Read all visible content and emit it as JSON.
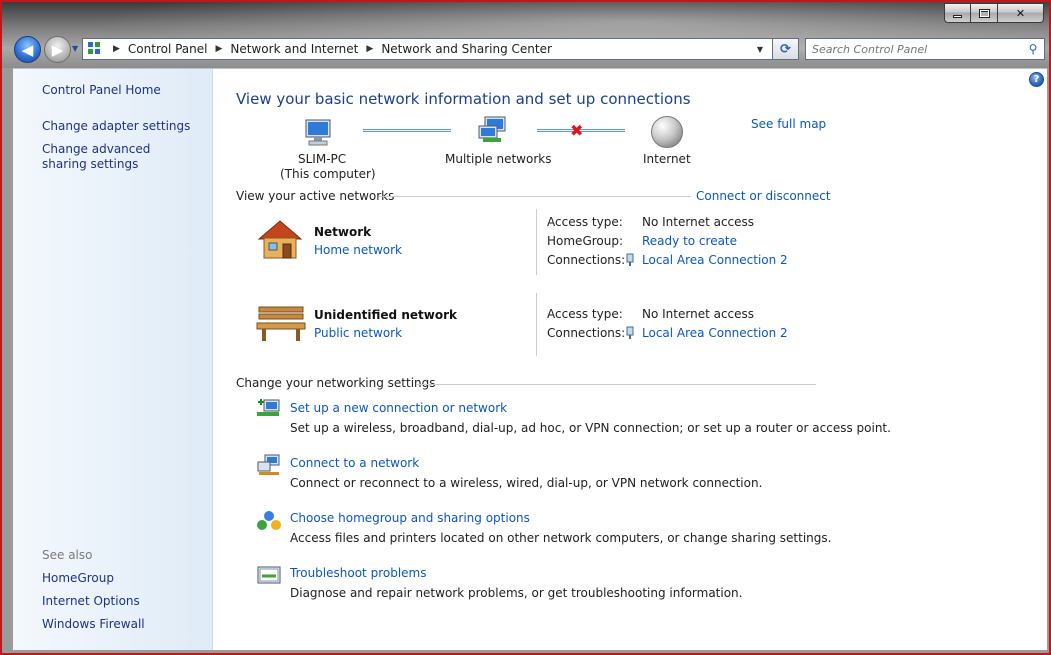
{
  "window": {
    "caption": {
      "minimize": "",
      "maximize": "",
      "close": "✕"
    }
  },
  "address": {
    "crumbs": [
      "Control Panel",
      "Network and Internet",
      "Network and Sharing Center"
    ]
  },
  "search": {
    "placeholder": "Search Control Panel"
  },
  "sidebar": {
    "home": "Control Panel Home",
    "links": [
      "Change adapter settings",
      "Change advanced sharing settings"
    ],
    "see_also_heading": "See also",
    "see_also": [
      "HomeGroup",
      "Internet Options",
      "Windows Firewall"
    ]
  },
  "main": {
    "title": "View your basic network information and set up connections",
    "see_full_map": "See full map",
    "map": {
      "computer_name": "SLIM-PC",
      "computer_sub": "(This computer)",
      "middle": "Multiple networks",
      "internet": "Internet"
    },
    "active_heading": "View your active networks",
    "connect_disconnect": "Connect or disconnect",
    "networks": [
      {
        "name": "Network",
        "category": "Home network",
        "rows": [
          {
            "label": "Access type:",
            "value": "No Internet access"
          },
          {
            "label": "HomeGroup:",
            "value": "Ready to create"
          },
          {
            "label": "Connections:",
            "value": "Local Area Connection 2"
          }
        ]
      },
      {
        "name": "Unidentified network",
        "category": "Public network",
        "rows": [
          {
            "label": "Access type:",
            "value": "No Internet access"
          },
          {
            "label": "Connections:",
            "value": "Local Area Connection 2"
          }
        ]
      }
    ],
    "settings_heading": "Change your networking settings",
    "tasks": [
      {
        "link": "Set up a new connection or network",
        "desc": "Set up a wireless, broadband, dial-up, ad hoc, or VPN connection; or set up a router or access point."
      },
      {
        "link": "Connect to a network",
        "desc": "Connect or reconnect to a wireless, wired, dial-up, or VPN network connection."
      },
      {
        "link": "Choose homegroup and sharing options",
        "desc": "Access files and printers located on other network computers, or change sharing settings."
      },
      {
        "link": "Troubleshoot problems",
        "desc": "Diagnose and repair network problems, or get troubleshooting information."
      }
    ]
  },
  "icons": {
    "back": "◀",
    "forward": "▶",
    "dropdown": "▼",
    "crumb_sep": "▶",
    "refresh": "⟳",
    "search": "⚲",
    "help": "?",
    "x": "✖"
  }
}
